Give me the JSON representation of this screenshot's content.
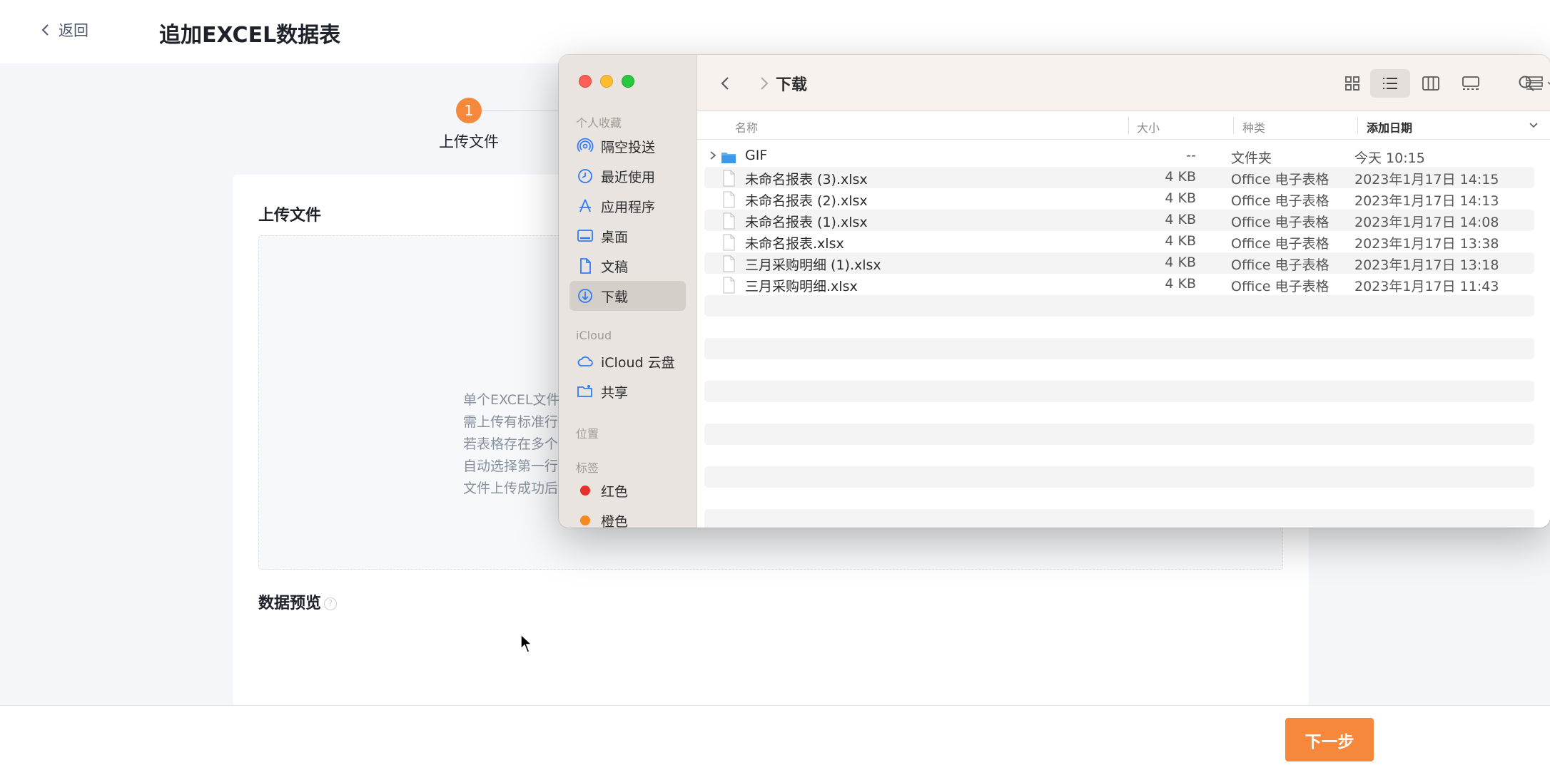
{
  "page": {
    "back_label": "返回",
    "title": "追加EXCEL数据表",
    "step_number": "1",
    "step_label": "上传文件",
    "upload_section_title": "上传文件",
    "hints": [
      "单个EXCEL文件",
      "需上传有标准行",
      "若表格存在多个",
      "自动选择第一行",
      "文件上传成功后"
    ],
    "preview_title": "数据预览",
    "help_glyph": "?",
    "next_button": "下一步",
    "accent_color": "#f5883a"
  },
  "finder": {
    "title": "下载",
    "sidebar": {
      "favorites_header": "个人收藏",
      "favorites": [
        {
          "label": "隔空投送",
          "icon": "airdrop-icon"
        },
        {
          "label": "最近使用",
          "icon": "clock-icon"
        },
        {
          "label": "应用程序",
          "icon": "applications-icon"
        },
        {
          "label": "桌面",
          "icon": "desktop-icon"
        },
        {
          "label": "文稿",
          "icon": "document-icon"
        },
        {
          "label": "下载",
          "icon": "download-icon",
          "active": true
        }
      ],
      "icloud_header": "iCloud",
      "icloud": [
        {
          "label": "iCloud 云盘",
          "icon": "cloud-icon"
        },
        {
          "label": "共享",
          "icon": "shared-folder-icon"
        }
      ],
      "locations_header": "位置",
      "tags_header": "标签",
      "tags": [
        {
          "label": "红色",
          "color": "#e8302a"
        },
        {
          "label": "橙色",
          "color": "#f58a1f"
        }
      ]
    },
    "columns": {
      "name": "名称",
      "size": "大小",
      "kind": "种类",
      "date": "添加日期"
    },
    "files": [
      {
        "name": "GIF",
        "size": "--",
        "kind": "文件夹",
        "date": "今天 10:15",
        "type": "folder"
      },
      {
        "name": "未命名报表 (3).xlsx",
        "size": "4 KB",
        "kind": "Office 电子表格",
        "date": "2023年1月17日 14:15",
        "type": "file"
      },
      {
        "name": "未命名报表 (2).xlsx",
        "size": "4 KB",
        "kind": "Office 电子表格",
        "date": "2023年1月17日 14:13",
        "type": "file"
      },
      {
        "name": "未命名报表 (1).xlsx",
        "size": "4 KB",
        "kind": "Office 电子表格",
        "date": "2023年1月17日 14:08",
        "type": "file"
      },
      {
        "name": "未命名报表.xlsx",
        "size": "4 KB",
        "kind": "Office 电子表格",
        "date": "2023年1月17日 13:38",
        "type": "file"
      },
      {
        "name": "三月采购明细 (1).xlsx",
        "size": "4 KB",
        "kind": "Office 电子表格",
        "date": "2023年1月17日 13:18",
        "type": "file"
      },
      {
        "name": "三月采购明细.xlsx",
        "size": "4 KB",
        "kind": "Office 电子表格",
        "date": "2023年1月17日 11:43",
        "type": "file"
      }
    ]
  }
}
